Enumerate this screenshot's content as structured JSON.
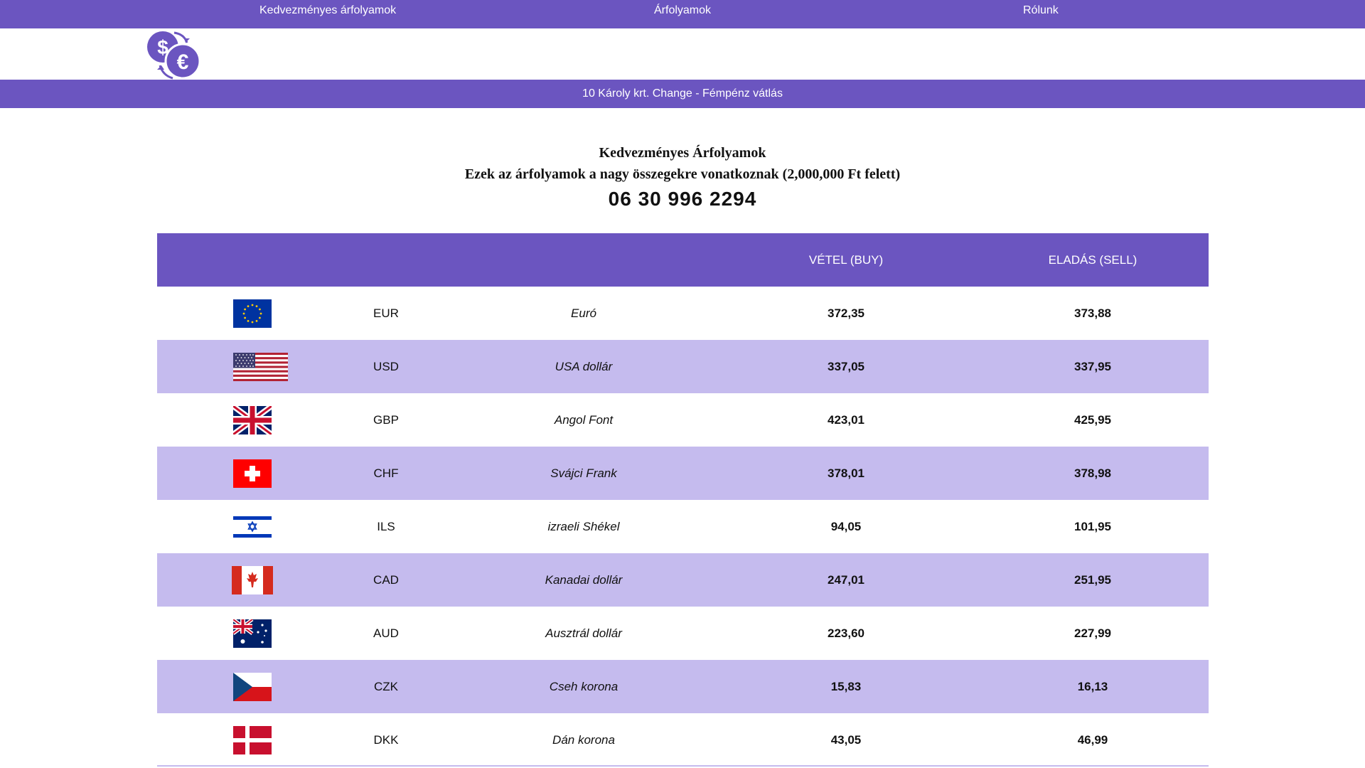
{
  "nav": {
    "items": [
      "Kedvezményes árfolyamok",
      "Árfolyamok",
      "Rólunk"
    ]
  },
  "logo": {
    "icon": "currency-exchange-icon"
  },
  "subbar": {
    "text": "10 Károly krt. Change - Fémpénz vátlás"
  },
  "headings": {
    "title": "Kedvezményes Árfolyamok",
    "subtitle": "Ezek az árfolyamok a nagy összegekre vonatkoznak (2,000,000 Ft felett)",
    "phone": "06 30 996 2294"
  },
  "table": {
    "headers": [
      "",
      "",
      "",
      "VÉTEL (BUY)",
      "ELADÁS (SELL)"
    ],
    "rows": [
      {
        "flag": "eu-flag-icon",
        "code": "EUR",
        "name": "Euró",
        "buy": "372,35",
        "sell": "373,88"
      },
      {
        "flag": "us-flag-icon",
        "code": "USD",
        "name": "USA dollár",
        "buy": "337,05",
        "sell": "337,95"
      },
      {
        "flag": "uk-flag-icon",
        "code": "GBP",
        "name": "Angol Font",
        "buy": "423,01",
        "sell": "425,95"
      },
      {
        "flag": "ch-flag-icon",
        "code": "CHF",
        "name": "Svájci Frank",
        "buy": "378,01",
        "sell": "378,98"
      },
      {
        "flag": "il-flag-icon",
        "code": "ILS",
        "name": "izraeli Shékel",
        "buy": "94,05",
        "sell": "101,95"
      },
      {
        "flag": "ca-flag-icon",
        "code": "CAD",
        "name": "Kanadai dollár",
        "buy": "247,01",
        "sell": "251,95"
      },
      {
        "flag": "au-flag-icon",
        "code": "AUD",
        "name": "Ausztrál dollár",
        "buy": "223,60",
        "sell": "227,99"
      },
      {
        "flag": "cz-flag-icon",
        "code": "CZK",
        "name": "Cseh korona",
        "buy": "15,83",
        "sell": "16,13"
      },
      {
        "flag": "dk-flag-icon",
        "code": "DKK",
        "name": "Dán korona",
        "buy": "43,05",
        "sell": "46,99"
      }
    ]
  },
  "colors": {
    "brand": "#6b55c0",
    "alt_row": "#c5bbee"
  }
}
